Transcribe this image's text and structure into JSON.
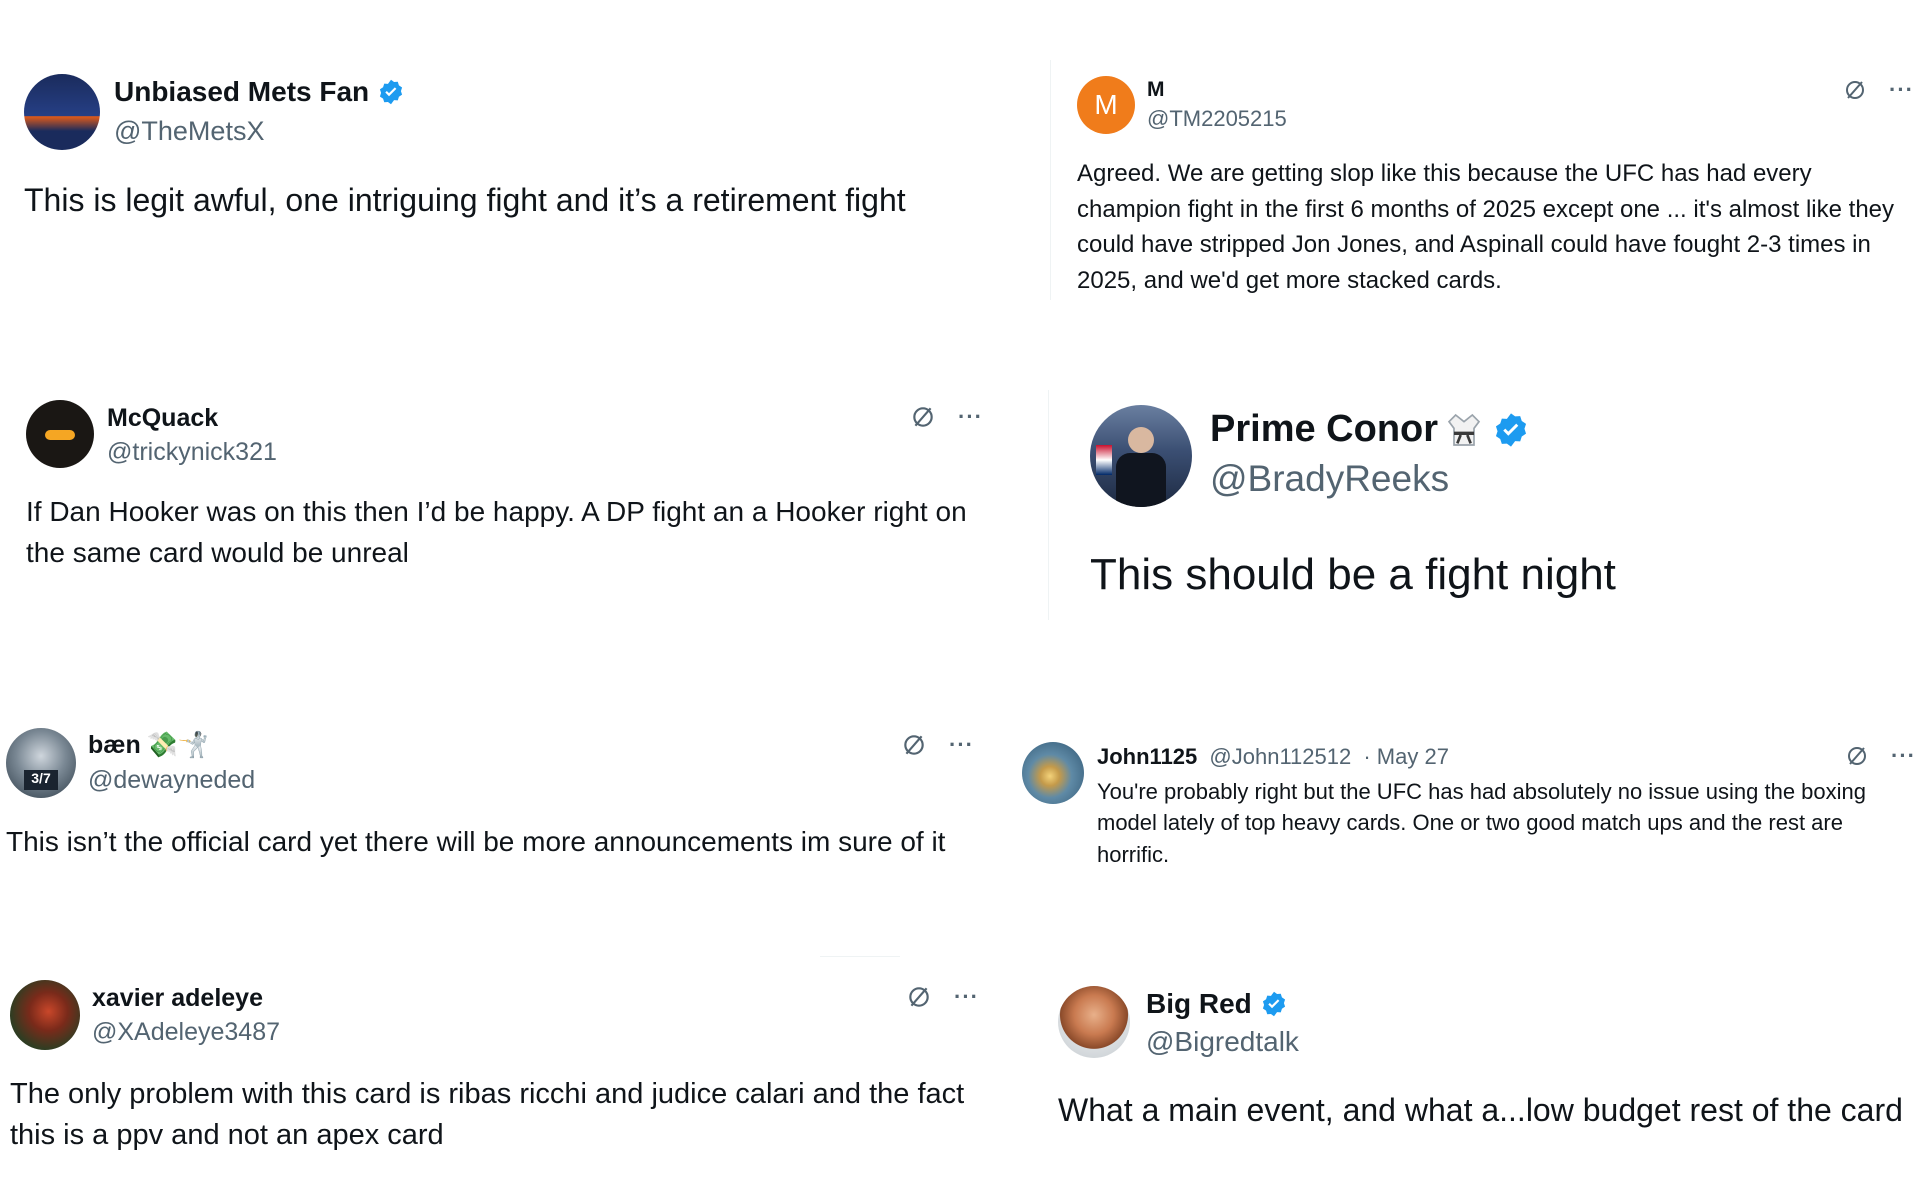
{
  "tweets": [
    {
      "name": "Unbiased Mets Fan",
      "handle": "@TheMetsX",
      "verified": true,
      "text": "This is legit awful, one intriguing fight and it’s a retirement fight"
    },
    {
      "name": "M",
      "handle": "@TM2205215",
      "avatar_letter": "M",
      "avatar_color": "#f07c1b",
      "text": "Agreed. We are getting slop like this because the UFC has had every champion fight in the first 6 months of 2025 except one ... it's almost like they could have stripped Jon Jones, and Aspinall could have fought 2-3 times in 2025, and we'd get more stacked cards."
    },
    {
      "name": "McQuack",
      "handle": "@trickynick321",
      "text": "If Dan Hooker was on this then I’d be happy. A DP fight an a Hooker right on the same card would be unreal"
    },
    {
      "name": "Prime Conor",
      "handle": "@BradyReeks",
      "verified": true,
      "text": "This should be a fight night"
    },
    {
      "name": "bæn",
      "name_emoji": "💸🤺",
      "handle": "@dewayneded",
      "text": "This isn’t the official card yet there will be more announcements im sure of it"
    },
    {
      "name": "John1125",
      "handle": "@John112512",
      "time": "· May 27",
      "text": "You're probably right but the UFC has had absolutely no issue using the boxing model lately of top heavy cards. One or two good match ups and the rest are horrific."
    },
    {
      "name": "xavier adeleye",
      "handle": "@XAdeleye3487",
      "text": "The only problem with this card is ribas ricchi and judice calari and the fact this is a ppv and not an apex card"
    },
    {
      "name": "Big Red",
      "handle": "@Bigredtalk",
      "verified": true,
      "text": "What a main event, and what a...low budget rest of the card"
    }
  ],
  "icons": {
    "verified": "verified-badge-icon",
    "grok": "grok-icon",
    "more": "more-options-icon"
  },
  "colors": {
    "verified_blue": "#1d9bf0",
    "secondary_text": "#536471"
  }
}
